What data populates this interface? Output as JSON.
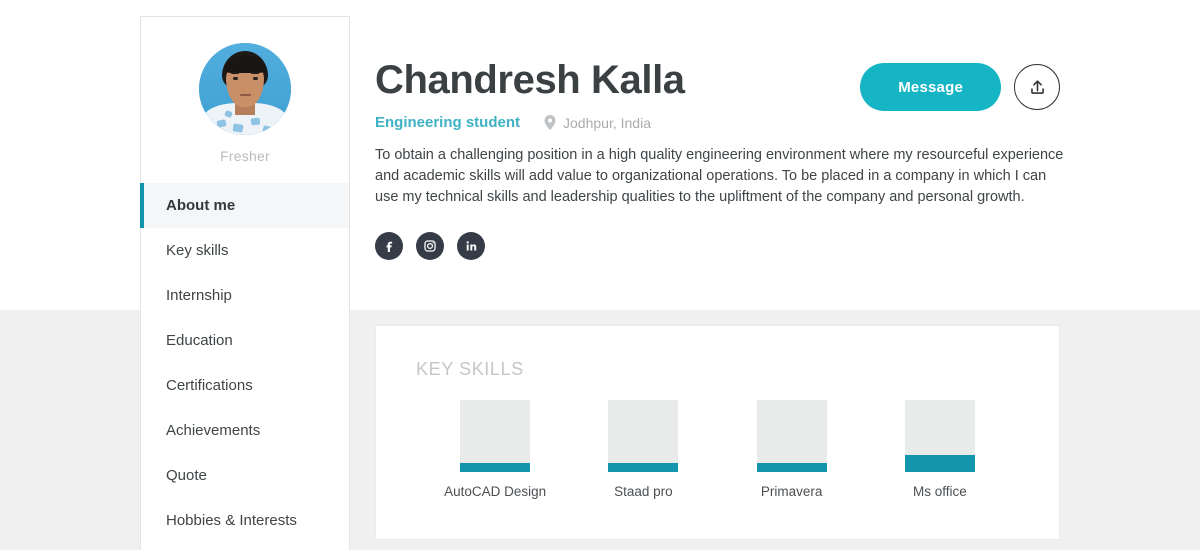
{
  "sidebar": {
    "avatar_alt": "profile-photo",
    "status_label": "Fresher",
    "items": [
      {
        "label": "About me",
        "active": true
      },
      {
        "label": "Key skills",
        "active": false
      },
      {
        "label": "Internship",
        "active": false
      },
      {
        "label": "Education",
        "active": false
      },
      {
        "label": "Certifications",
        "active": false
      },
      {
        "label": "Achievements",
        "active": false
      },
      {
        "label": "Quote",
        "active": false
      },
      {
        "label": "Hobbies & Interests",
        "active": false
      }
    ]
  },
  "header": {
    "name": "Chandresh Kalla",
    "role": "Engineering student",
    "location": "Jodhpur, India",
    "bio": "To obtain a challenging position in a high quality engineering environment where my resourceful experience and academic skills will add value to organizational operations. To be placed in a company in which I can use my technical skills and leadership qualities to the upliftment of the company and personal growth.",
    "message_label": "Message",
    "share_icon": "upload-icon",
    "location_icon": "map-pin-icon",
    "social": [
      {
        "name": "facebook-icon",
        "glyph": "f"
      },
      {
        "name": "instagram-icon",
        "glyph": ""
      },
      {
        "name": "linkedin-icon",
        "glyph": "in"
      }
    ]
  },
  "skills_card": {
    "heading": "KEY SKILLS"
  },
  "chart_data": {
    "type": "bar",
    "title": "KEY SKILLS",
    "categories": [
      "AutoCAD Design",
      "Staad pro",
      "Primavera",
      "Ms office"
    ],
    "values": [
      12,
      12,
      12,
      24
    ],
    "ylim": [
      0,
      100
    ],
    "xlabel": "",
    "ylabel": "",
    "grid": false,
    "legend": "none",
    "orientation": "vertical",
    "bar_color": "#1295ad",
    "track_color": "#e9eaea"
  },
  "colors": {
    "accent_teal": "#1295ad",
    "button_teal": "#16b5c6",
    "role_teal": "#3fb2c4",
    "page_background": "#f0f0f0",
    "card_background": "#ffffff",
    "text_dark": "#3f4447",
    "text_muted": "#a9acae"
  }
}
